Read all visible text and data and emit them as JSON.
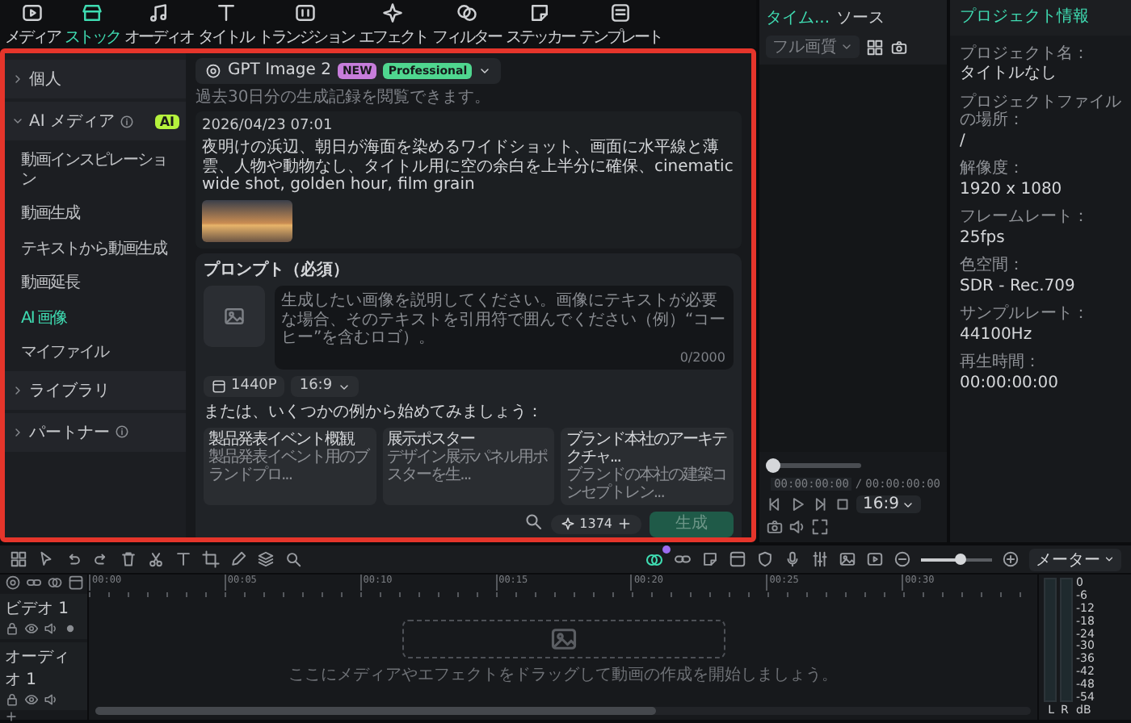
{
  "toolbar": {
    "items": [
      {
        "label": "メディア",
        "selected": false
      },
      {
        "label": "ストック",
        "selected": true
      },
      {
        "label": "オーディオ",
        "selected": false
      },
      {
        "label": "タイトル",
        "selected": false
      },
      {
        "label": "トランジション",
        "selected": false
      },
      {
        "label": "エフェクト",
        "selected": false
      },
      {
        "label": "フィルター",
        "selected": false
      },
      {
        "label": "ステッカー",
        "selected": false
      },
      {
        "label": "テンプレート",
        "selected": false
      }
    ]
  },
  "nav": {
    "items": [
      {
        "label": "個人",
        "expanded": false,
        "info": false
      },
      {
        "label": "AI メディア",
        "expanded": true,
        "info": true,
        "badge": "AI",
        "children": [
          {
            "label": "動画インスピレーション",
            "selected": false
          },
          {
            "label": "動画生成",
            "selected": false
          },
          {
            "label": "テキストから動画生成",
            "selected": false
          },
          {
            "label": "動画延長",
            "selected": false
          },
          {
            "label": "AI 画像",
            "selected": true
          },
          {
            "label": "マイファイル",
            "selected": false
          }
        ]
      },
      {
        "label": "ライブラリ",
        "expanded": false,
        "info": false
      },
      {
        "label": "パートナー",
        "expanded": false,
        "info": true
      }
    ]
  },
  "generator": {
    "model": "GPT Image 2",
    "badges": [
      {
        "label": "NEW",
        "color": "#c77ddb"
      },
      {
        "label": "Professional",
        "color": "#4fd68f"
      }
    ],
    "history_note": "過去30日分の生成記録を閲覧できます。",
    "history": [
      {
        "date": "2026/04/23 07:01",
        "prompt": "夜明けの浜辺、朝日が海面を染めるワイドショット、画面に水平線と薄雲、人物や動物なし、タイトル用に空の余白を上半分に確保、cinematic wide shot, golden hour, film grain"
      }
    ],
    "prompt_card": {
      "title": "プロンプト（必須）",
      "placeholder": "生成したい画像を説明してください。画像にテキストが必要な場合、そのテキストを引用符で囲んでください（例）“コーヒー”を含むロゴ）。",
      "counter": "0/2000",
      "resolution": "1440P",
      "ratio": "16:9",
      "examples_label": "または、いくつかの例から始めてみましょう：",
      "examples": [
        {
          "title": "製品発表イベント概観",
          "description": "製品発表イベント用のブランドプロ..."
        },
        {
          "title": "展示ポスター",
          "description": "デザイン展示パネル用ポスターを生..."
        },
        {
          "title": "ブランド本社のアーキテクチャ...",
          "description": "ブランドの本社の建築コンセプトレン..."
        }
      ],
      "credits": "1374",
      "generate": {
        "label": "生成",
        "disabled": true
      }
    }
  },
  "player": {
    "tabs": [
      {
        "label": "タイム...",
        "selected": true
      },
      {
        "label": "ソース",
        "selected": false
      }
    ],
    "quality": "フル画質",
    "level": 0,
    "current_time": "00:00:00:00",
    "separator": "/",
    "total_time": "00:00:00:00",
    "ratio": "16:9"
  },
  "info": {
    "title": "プロジェクト情報",
    "rows": [
      {
        "label": "プロジェクト名：",
        "value": "タイトルなし"
      },
      {
        "label": "プロジェクトファイルの場所：",
        "value": "/"
      },
      {
        "label": "解像度：",
        "value": "1920 x 1080"
      },
      {
        "label": "フレームレート：",
        "value": "25fps"
      },
      {
        "label": "色空間：",
        "value": "SDR - Rec.709"
      },
      {
        "label": "サンプルレート：",
        "value": "44100Hz"
      },
      {
        "label": "再生時間：",
        "value": "00:00:00:00"
      }
    ]
  },
  "timeline": {
    "meter_label": "メーター",
    "zoom": {
      "level": 0.55
    },
    "ruler": [
      "00:00",
      "00:05",
      "00:10",
      "00:15",
      "00:20",
      "00:25",
      "00:30"
    ],
    "tracks": [
      {
        "name": "ビデオ 1",
        "kind": "video"
      },
      {
        "name": "オーディオ 1",
        "kind": "audio"
      }
    ],
    "drop_hint": "ここにメディアやエフェクトをドラッグして動画の作成を開始しましょう。",
    "meter_scale": [
      "0",
      "-6",
      "-12",
      "-18",
      "-24",
      "-30",
      "-36",
      "-42",
      "-48",
      "-54",
      "dB"
    ],
    "channels": [
      "L",
      "R"
    ]
  }
}
